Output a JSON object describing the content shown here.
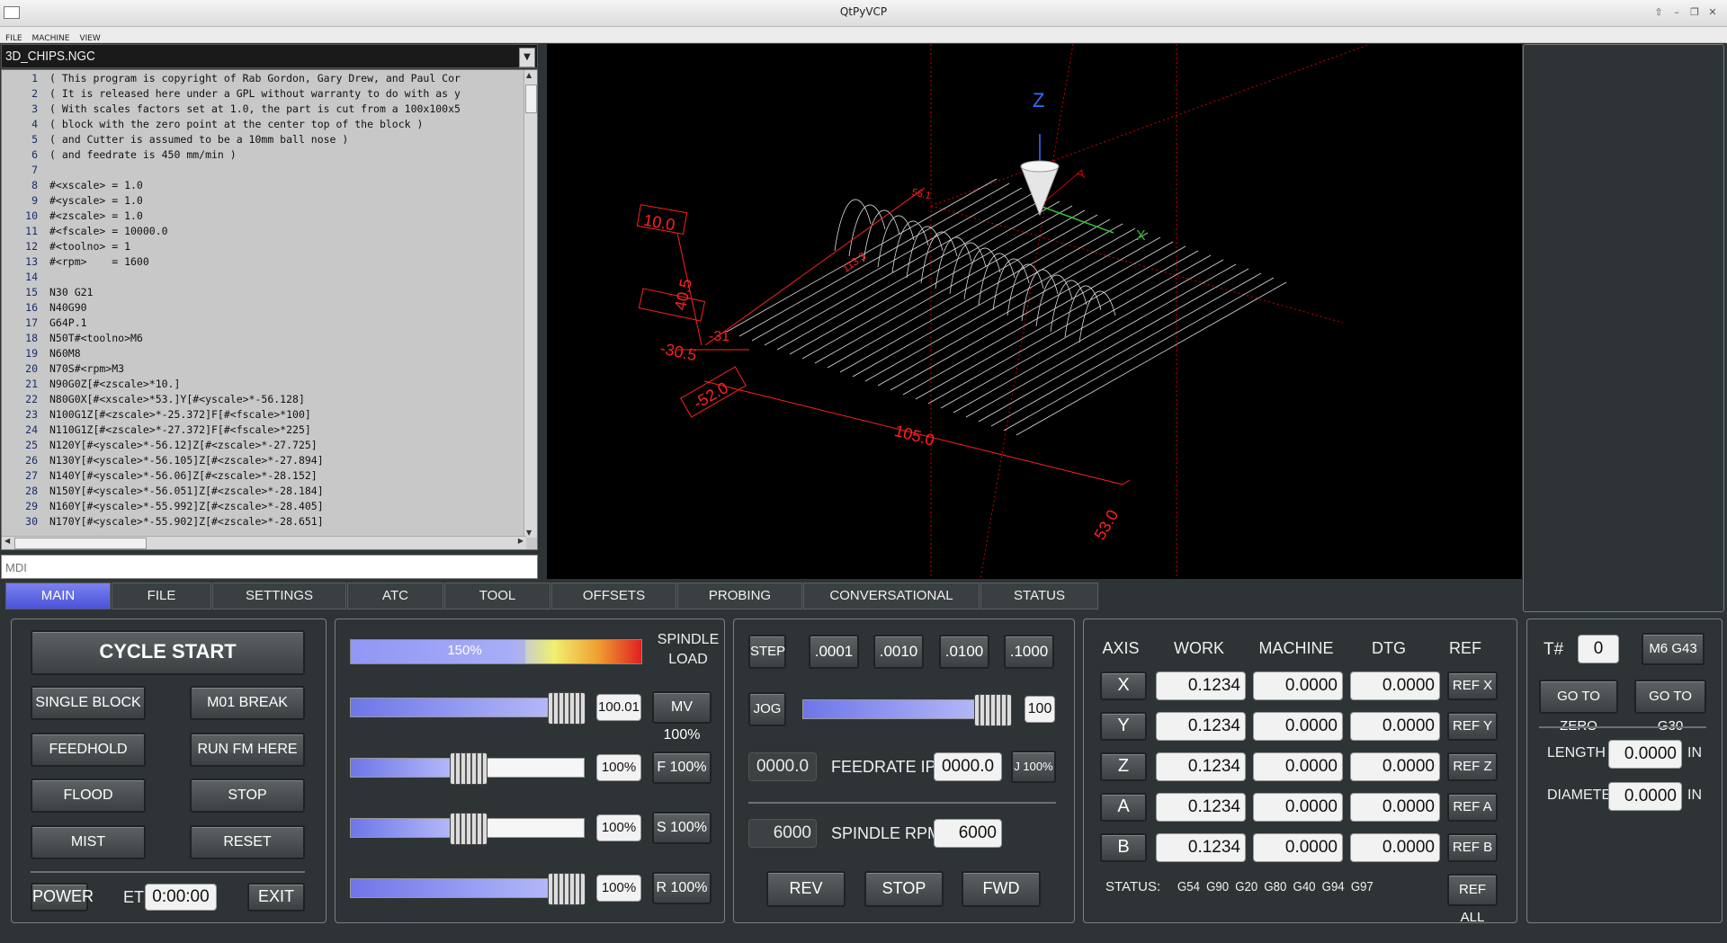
{
  "window": {
    "title": "QtPyVCP"
  },
  "menu": [
    "FILE",
    "MACHINE",
    "VIEW"
  ],
  "editor": {
    "filename": "3D_CHIPS.NGC",
    "lines": [
      {
        "n": "1",
        "t": "( This program is copyright of Rab Gordon, Gary Drew, and Paul Cor"
      },
      {
        "n": "2",
        "t": "( It is released here under a GPL without warranty to do with as y"
      },
      {
        "n": "3",
        "t": "( With scales factors set at 1.0, the part is cut from a 100x100x5"
      },
      {
        "n": "4",
        "t": "( block with the zero point at the center top of the block )"
      },
      {
        "n": "5",
        "t": "( and Cutter is assumed to be a 10mm ball nose )"
      },
      {
        "n": "6",
        "t": "( and feedrate is 450 mm/min )"
      },
      {
        "n": "7",
        "t": ""
      },
      {
        "n": "8",
        "t": "#<xscale> = 1.0"
      },
      {
        "n": "9",
        "t": "#<yscale> = 1.0"
      },
      {
        "n": "10",
        "t": "#<zscale> = 1.0"
      },
      {
        "n": "11",
        "t": "#<fscale> = 10000.0"
      },
      {
        "n": "12",
        "t": "#<toolno> = 1"
      },
      {
        "n": "13",
        "t": "#<rpm>    = 1600"
      },
      {
        "n": "14",
        "t": ""
      },
      {
        "n": "15",
        "t": "N30 G21"
      },
      {
        "n": "16",
        "t": "N40G90"
      },
      {
        "n": "17",
        "t": "G64P.1"
      },
      {
        "n": "18",
        "t": "N50T#<toolno>M6"
      },
      {
        "n": "19",
        "t": "N60M8"
      },
      {
        "n": "20",
        "t": "N70S#<rpm>M3"
      },
      {
        "n": "21",
        "t": "N90G0Z[#<zscale>*10.]"
      },
      {
        "n": "22",
        "t": "N80G0X[#<xscale>*53.]Y[#<yscale>*-56.128]"
      },
      {
        "n": "23",
        "t": "N100G1Z[#<zscale>*-25.372]F[#<fscale>*100]"
      },
      {
        "n": "24",
        "t": "N110G1Z[#<zscale>*-27.372]F[#<fscale>*225]"
      },
      {
        "n": "25",
        "t": "N120Y[#<yscale>*-56.12]Z[#<zscale>*-27.725]"
      },
      {
        "n": "26",
        "t": "N130Y[#<yscale>*-56.105]Z[#<zscale>*-27.894]"
      },
      {
        "n": "27",
        "t": "N140Y[#<yscale>*-56.06]Z[#<zscale>*-28.152]"
      },
      {
        "n": "28",
        "t": "N150Y[#<yscale>*-56.051]Z[#<zscale>*-28.184]"
      },
      {
        "n": "29",
        "t": "N160Y[#<yscale>*-55.992]Z[#<zscale>*-28.405]"
      },
      {
        "n": "30",
        "t": "N170Y[#<yscale>*-55.902]Z[#<zscale>*-28.651]"
      }
    ]
  },
  "mdi": {
    "placeholder": "MDI"
  },
  "viewer": {
    "axis_z": "Z",
    "axis_y": "Y",
    "axis_x": "X",
    "dims": {
      "d1": "10.0",
      "d2": "40.5",
      "d3": "-30.5",
      "d4": "-52.0",
      "d5": "105.0",
      "d6": "53.0",
      "d7": "113.3",
      "d8": "56.1",
      "d9": "-31"
    }
  },
  "tabs": [
    "MAIN",
    "FILE",
    "SETTINGS",
    "ATC",
    "TOOL",
    "OFFSETS",
    "PROBING",
    "CONVERSATIONAL",
    "STATUS"
  ],
  "program_controls": {
    "cycle_start": "CYCLE START",
    "single_block": "SINGLE BLOCK",
    "m01_break": "M01 BREAK",
    "feedhold": "FEEDHOLD",
    "run_fm_here": "RUN FM HERE",
    "flood": "FLOOD",
    "stop": "STOP",
    "mist": "MIST",
    "reset": "RESET",
    "power": "POWER",
    "et_label": "ET",
    "et_value": "0:00:00",
    "exit": "EXIT"
  },
  "overrides": {
    "spindle_load_label": "SPINDLE LOAD",
    "spindle_load_bar_text": "150%",
    "spindle_load_fraction": 0.6,
    "rows": [
      {
        "value": "100.01",
        "button": "MV 100%",
        "fraction": 1.0
      },
      {
        "value": "100%",
        "button": "F 100%",
        "fraction": 0.5
      },
      {
        "value": "100%",
        "button": "S 100%",
        "fraction": 0.5
      },
      {
        "value": "100%",
        "button": "R 100%",
        "fraction": 1.0
      }
    ]
  },
  "jog": {
    "step": "STEP",
    "increments": [
      ".0001",
      ".0010",
      ".0100",
      ".1000"
    ],
    "jog": "JOG",
    "jog_value": "100",
    "jog_fraction": 1.0,
    "feed_actual": "0000.0",
    "feed_label": "FEEDRATE IPM",
    "feed_set": "0000.0",
    "j100": "J 100%",
    "spindle_actual": "6000",
    "spindle_label": "SPINDLE RPM",
    "spindle_set": "6000",
    "rev": "REV",
    "stop": "STOP",
    "fwd": "FWD"
  },
  "dro": {
    "headers": [
      "AXIS",
      "WORK",
      "MACHINE",
      "DTG",
      "REF"
    ],
    "rows": [
      {
        "axis": "X",
        "work": "0.1234",
        "machine": "0.0000",
        "dtg": "0.0000",
        "ref": "REF X"
      },
      {
        "axis": "Y",
        "work": "0.1234",
        "machine": "0.0000",
        "dtg": "0.0000",
        "ref": "REF Y"
      },
      {
        "axis": "Z",
        "work": "0.1234",
        "machine": "0.0000",
        "dtg": "0.0000",
        "ref": "REF Z"
      },
      {
        "axis": "A",
        "work": "0.1234",
        "machine": "0.0000",
        "dtg": "0.0000",
        "ref": "REF A"
      },
      {
        "axis": "B",
        "work": "0.1234",
        "machine": "0.0000",
        "dtg": "0.0000",
        "ref": "REF B"
      }
    ],
    "status_label": "STATUS:",
    "status_codes": "G54 G90 G20 G80 G40 G94 G97",
    "ref_all": "REF ALL"
  },
  "tool": {
    "tnum_label": "T#",
    "tnum_value": "0",
    "m6g43": "M6 G43",
    "go_zero": "GO TO ZERO",
    "go_g30": "GO TO G30",
    "length_label": "LENGTH",
    "length_value": "0.0000",
    "length_unit": "IN",
    "diameter_label": "DIAMETER",
    "diameter_value": "0.0000",
    "diameter_unit": "IN"
  },
  "colors": {
    "accent": "#5a62e0",
    "bg": "#2e3436",
    "field": "#f2f2f2",
    "dim_red": "#ff2020"
  }
}
